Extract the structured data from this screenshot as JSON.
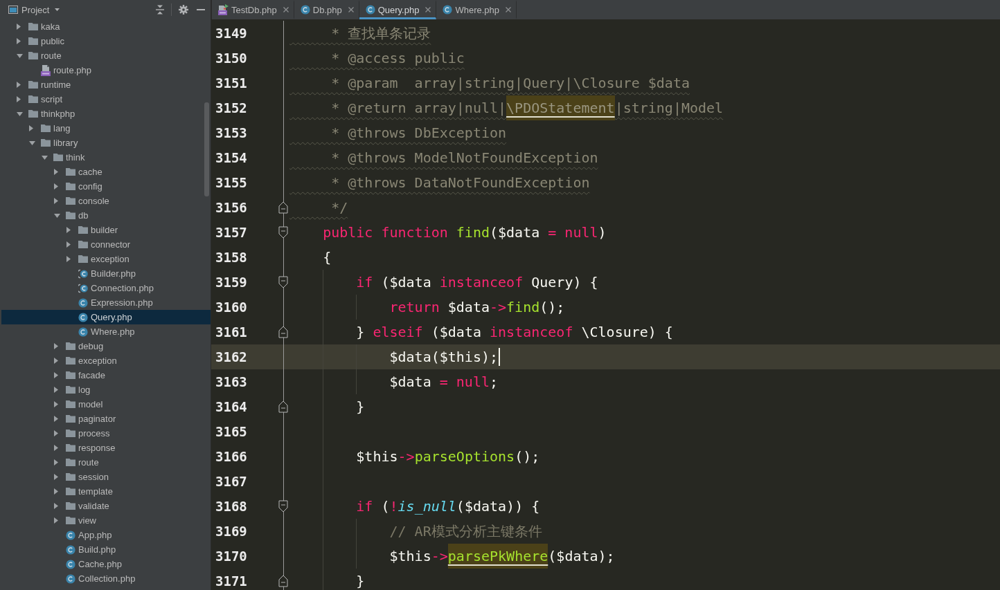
{
  "sidebar": {
    "title": "Project",
    "tree": [
      {
        "label": "kaka",
        "kind": "folder",
        "expanded": false,
        "selected": false
      },
      {
        "label": "public",
        "kind": "folder",
        "expanded": false,
        "selected": false
      },
      {
        "label": "route",
        "kind": "folder",
        "expanded": true,
        "selected": false,
        "children": [
          {
            "label": "route.php",
            "kind": "php-file",
            "selected": false
          }
        ]
      },
      {
        "label": "runtime",
        "kind": "folder",
        "expanded": false,
        "selected": false
      },
      {
        "label": "script",
        "kind": "folder",
        "expanded": false,
        "selected": false
      },
      {
        "label": "thinkphp",
        "kind": "folder",
        "expanded": true,
        "selected": false,
        "children": [
          {
            "label": "lang",
            "kind": "folder",
            "expanded": false,
            "selected": false
          },
          {
            "label": "library",
            "kind": "folder",
            "expanded": true,
            "selected": false,
            "children": [
              {
                "label": "think",
                "kind": "folder",
                "expanded": true,
                "selected": false,
                "children": [
                  {
                    "label": "cache",
                    "kind": "folder",
                    "expanded": false,
                    "selected": false
                  },
                  {
                    "label": "config",
                    "kind": "folder",
                    "expanded": false,
                    "selected": false
                  },
                  {
                    "label": "console",
                    "kind": "folder",
                    "expanded": false,
                    "selected": false
                  },
                  {
                    "label": "db",
                    "kind": "folder",
                    "expanded": true,
                    "selected": false,
                    "children": [
                      {
                        "label": "builder",
                        "kind": "folder",
                        "expanded": false,
                        "selected": false
                      },
                      {
                        "label": "connector",
                        "kind": "folder",
                        "expanded": false,
                        "selected": false
                      },
                      {
                        "label": "exception",
                        "kind": "folder",
                        "expanded": false,
                        "selected": false
                      },
                      {
                        "label": "Builder.php",
                        "kind": "abstract-class",
                        "selected": false
                      },
                      {
                        "label": "Connection.php",
                        "kind": "abstract-class",
                        "selected": false
                      },
                      {
                        "label": "Expression.php",
                        "kind": "class",
                        "selected": false
                      },
                      {
                        "label": "Query.php",
                        "kind": "class",
                        "selected": true
                      },
                      {
                        "label": "Where.php",
                        "kind": "class",
                        "selected": false
                      }
                    ]
                  },
                  {
                    "label": "debug",
                    "kind": "folder",
                    "expanded": false,
                    "selected": false
                  },
                  {
                    "label": "exception",
                    "kind": "folder",
                    "expanded": false,
                    "selected": false
                  },
                  {
                    "label": "facade",
                    "kind": "folder",
                    "expanded": false,
                    "selected": false
                  },
                  {
                    "label": "log",
                    "kind": "folder",
                    "expanded": false,
                    "selected": false
                  },
                  {
                    "label": "model",
                    "kind": "folder",
                    "expanded": false,
                    "selected": false
                  },
                  {
                    "label": "paginator",
                    "kind": "folder",
                    "expanded": false,
                    "selected": false
                  },
                  {
                    "label": "process",
                    "kind": "folder",
                    "expanded": false,
                    "selected": false
                  },
                  {
                    "label": "response",
                    "kind": "folder",
                    "expanded": false,
                    "selected": false
                  },
                  {
                    "label": "route",
                    "kind": "folder",
                    "expanded": false,
                    "selected": false
                  },
                  {
                    "label": "session",
                    "kind": "folder",
                    "expanded": false,
                    "selected": false
                  },
                  {
                    "label": "template",
                    "kind": "folder",
                    "expanded": false,
                    "selected": false
                  },
                  {
                    "label": "validate",
                    "kind": "folder",
                    "expanded": false,
                    "selected": false
                  },
                  {
                    "label": "view",
                    "kind": "folder",
                    "expanded": false,
                    "selected": false
                  },
                  {
                    "label": "App.php",
                    "kind": "class",
                    "selected": false
                  },
                  {
                    "label": "Build.php",
                    "kind": "class",
                    "selected": false
                  },
                  {
                    "label": "Cache.php",
                    "kind": "class",
                    "selected": false
                  },
                  {
                    "label": "Collection.php",
                    "kind": "class",
                    "selected": false
                  }
                ]
              }
            ]
          }
        ]
      }
    ]
  },
  "tabs": [
    {
      "label": "TestDb.php",
      "kind": "php-test",
      "selected": false
    },
    {
      "label": "Db.php",
      "kind": "class",
      "selected": false
    },
    {
      "label": "Query.php",
      "kind": "class",
      "selected": true
    },
    {
      "label": "Where.php",
      "kind": "class",
      "selected": false
    }
  ],
  "editor": {
    "lines": [
      {
        "number": "3149",
        "kind": "plain",
        "current": false,
        "tokens": [
          {
            "kind": "doc-comment",
            "text": "     * 查找单条记录"
          }
        ]
      },
      {
        "number": "3150",
        "kind": "plain",
        "current": false,
        "tokens": [
          {
            "kind": "doc-comment",
            "text": "     * @access public"
          }
        ]
      },
      {
        "number": "3151",
        "kind": "plain",
        "current": false,
        "tokens": [
          {
            "kind": "doc-comment",
            "text": "     * @param  array|string|Query|\\Closure $data"
          }
        ]
      },
      {
        "number": "3152",
        "kind": "plain",
        "current": false,
        "tokens": [
          {
            "kind": "doc-comment",
            "text": "     * @return array|null|"
          },
          {
            "kind": "doc-usage",
            "text": "\\PDOStatement"
          },
          {
            "kind": "doc-comment",
            "text": "|string|Model"
          }
        ]
      },
      {
        "number": "3153",
        "kind": "plain",
        "current": false,
        "tokens": [
          {
            "kind": "doc-comment",
            "text": "     * @throws DbException"
          }
        ]
      },
      {
        "number": "3154",
        "kind": "plain",
        "current": false,
        "tokens": [
          {
            "kind": "doc-comment",
            "text": "     * @throws ModelNotFoundException"
          }
        ]
      },
      {
        "number": "3155",
        "kind": "plain",
        "current": false,
        "tokens": [
          {
            "kind": "doc-comment",
            "text": "     * @throws DataNotFoundException"
          }
        ]
      },
      {
        "number": "3156",
        "kind": "fold-end",
        "current": false,
        "tokens": [
          {
            "kind": "doc-comment",
            "text": "     */"
          }
        ]
      },
      {
        "number": "3157",
        "kind": "fold-start",
        "current": false,
        "tokens": [
          {
            "kind": "keyword",
            "text": "    public function"
          },
          {
            "kind": "function",
            "text": " find"
          },
          {
            "kind": "text",
            "text": "($data"
          },
          {
            "kind": "keyword",
            "text": " = null"
          },
          {
            "kind": "text",
            "text": ")"
          }
        ]
      },
      {
        "number": "3158",
        "kind": "plain",
        "current": false,
        "tokens": [
          {
            "kind": "text",
            "text": "    {"
          }
        ]
      },
      {
        "number": "3159",
        "kind": "fold-start",
        "current": false,
        "tokens": [
          {
            "kind": "keyword",
            "text": "        if"
          },
          {
            "kind": "text",
            "text": " ($data"
          },
          {
            "kind": "keyword",
            "text": " instanceof"
          },
          {
            "kind": "text",
            "text": " Query) {"
          }
        ]
      },
      {
        "number": "3160",
        "kind": "plain",
        "current": false,
        "tokens": [
          {
            "kind": "keyword",
            "text": "            return"
          },
          {
            "kind": "text",
            "text": " $data"
          },
          {
            "kind": "keyword",
            "text": "->"
          },
          {
            "kind": "function",
            "text": "find"
          },
          {
            "kind": "text",
            "text": "();"
          }
        ]
      },
      {
        "number": "3161",
        "kind": "fold-end",
        "current": false,
        "tokens": [
          {
            "kind": "text",
            "text": "        }"
          },
          {
            "kind": "keyword",
            "text": " elseif"
          },
          {
            "kind": "text",
            "text": " ($data"
          },
          {
            "kind": "keyword",
            "text": " instanceof"
          },
          {
            "kind": "text",
            "text": " \\Closure) {"
          }
        ]
      },
      {
        "number": "3162",
        "kind": "plain",
        "current": true,
        "tokens": [
          {
            "kind": "text",
            "text": "            $data($this);"
          }
        ]
      },
      {
        "number": "3163",
        "kind": "plain",
        "current": false,
        "tokens": [
          {
            "kind": "text",
            "text": "            $data"
          },
          {
            "kind": "keyword",
            "text": " = null"
          },
          {
            "kind": "text",
            "text": ";"
          }
        ]
      },
      {
        "number": "3164",
        "kind": "fold-end",
        "current": false,
        "tokens": [
          {
            "kind": "text",
            "text": "        }"
          }
        ]
      },
      {
        "number": "3165",
        "kind": "plain",
        "current": false
      },
      {
        "number": "3166",
        "kind": "plain",
        "current": false,
        "tokens": [
          {
            "kind": "text",
            "text": "        $this"
          },
          {
            "kind": "keyword",
            "text": "->"
          },
          {
            "kind": "function",
            "text": "parseOptions"
          },
          {
            "kind": "text",
            "text": "();"
          }
        ]
      },
      {
        "number": "3167",
        "kind": "plain",
        "current": false
      },
      {
        "number": "3168",
        "kind": "fold-start",
        "current": false,
        "tokens": [
          {
            "kind": "keyword",
            "text": "        if"
          },
          {
            "kind": "text",
            "text": " ("
          },
          {
            "kind": "keyword",
            "text": "!"
          },
          {
            "kind": "builtin",
            "text": "is_null"
          },
          {
            "kind": "text",
            "text": "($data)) {"
          }
        ]
      },
      {
        "number": "3169",
        "kind": "plain",
        "current": false,
        "tokens": [
          {
            "kind": "comment",
            "text": "            // AR模式分析主键条件"
          }
        ]
      },
      {
        "number": "3170",
        "kind": "plain",
        "current": false,
        "tokens": [
          {
            "kind": "text",
            "text": "            $this"
          },
          {
            "kind": "keyword",
            "text": "->"
          },
          {
            "kind": "function-usage",
            "text": "parsePkWhere"
          },
          {
            "kind": "text",
            "text": "($data);"
          }
        ]
      },
      {
        "number": "3171",
        "kind": "fold-end",
        "current": false,
        "tokens": [
          {
            "kind": "text",
            "text": "        }"
          }
        ]
      }
    ]
  }
}
